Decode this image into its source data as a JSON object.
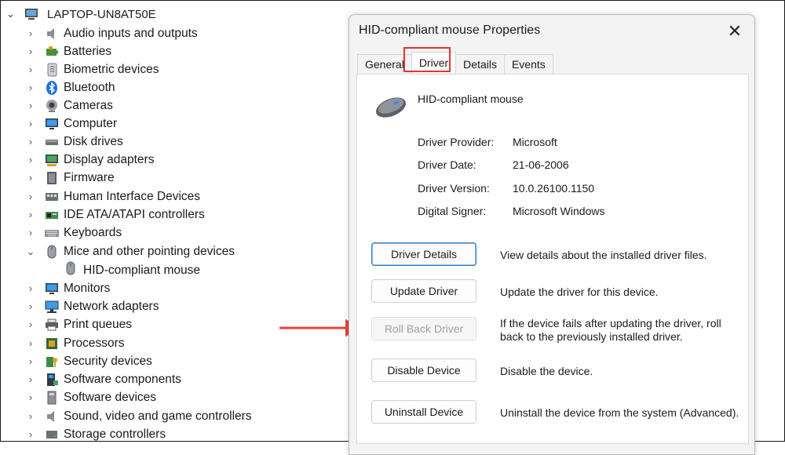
{
  "tree": {
    "root_label": "LAPTOP-UN8AT50E",
    "items": [
      {
        "label": "Audio inputs and outputs",
        "icon": "speaker-icon"
      },
      {
        "label": "Batteries",
        "icon": "battery-icon"
      },
      {
        "label": "Biometric devices",
        "icon": "fingerprint-icon"
      },
      {
        "label": "Bluetooth",
        "icon": "bluetooth-icon"
      },
      {
        "label": "Cameras",
        "icon": "camera-icon"
      },
      {
        "label": "Computer",
        "icon": "monitor-icon"
      },
      {
        "label": "Disk drives",
        "icon": "disk-icon"
      },
      {
        "label": "Display adapters",
        "icon": "display-adapter-icon"
      },
      {
        "label": "Firmware",
        "icon": "chip-icon"
      },
      {
        "label": "Human Interface Devices",
        "icon": "hid-icon"
      },
      {
        "label": "IDE ATA/ATAPI controllers",
        "icon": "controller-icon"
      },
      {
        "label": "Keyboards",
        "icon": "keyboard-icon"
      },
      {
        "label": "Mice and other pointing devices",
        "icon": "mouse-icon"
      },
      {
        "label": "Monitors",
        "icon": "monitor-icon"
      },
      {
        "label": "Network adapters",
        "icon": "network-icon"
      },
      {
        "label": "Print queues",
        "icon": "printer-icon"
      },
      {
        "label": "Processors",
        "icon": "processor-icon"
      },
      {
        "label": "Security devices",
        "icon": "security-icon"
      },
      {
        "label": "Software components",
        "icon": "component-icon"
      },
      {
        "label": "Software devices",
        "icon": "software-device-icon"
      },
      {
        "label": "Sound, video and game controllers",
        "icon": "speaker-icon"
      },
      {
        "label": "Storage controllers",
        "icon": "storage-icon"
      }
    ],
    "child_label": "HID-compliant mouse"
  },
  "dialog": {
    "title": "HID-compliant mouse Properties",
    "tabs": [
      "General",
      "Driver",
      "Details",
      "Events"
    ],
    "active_tab": "Driver",
    "device_name": "HID-compliant mouse",
    "info": [
      {
        "key": "Driver Provider:",
        "value": "Microsoft"
      },
      {
        "key": "Driver Date:",
        "value": "21-06-2006"
      },
      {
        "key": "Driver Version:",
        "value": "10.0.26100.1150"
      },
      {
        "key": "Digital Signer:",
        "value": "Microsoft Windows"
      }
    ],
    "actions": [
      {
        "label": "Driver Details",
        "desc": "View details about the installed driver files."
      },
      {
        "label": "Update Driver",
        "desc": "Update the driver for this device."
      },
      {
        "label": "Roll Back Driver",
        "desc": "If the device fails after updating the driver, roll back to the previously installed driver."
      },
      {
        "label": "Disable Device",
        "desc": "Disable the device."
      },
      {
        "label": "Uninstall Device",
        "desc": "Uninstall the device from the system (Advanced)."
      }
    ]
  },
  "colors": {
    "highlight": "#e0352b",
    "annotation_arrow": "#e8443a"
  }
}
